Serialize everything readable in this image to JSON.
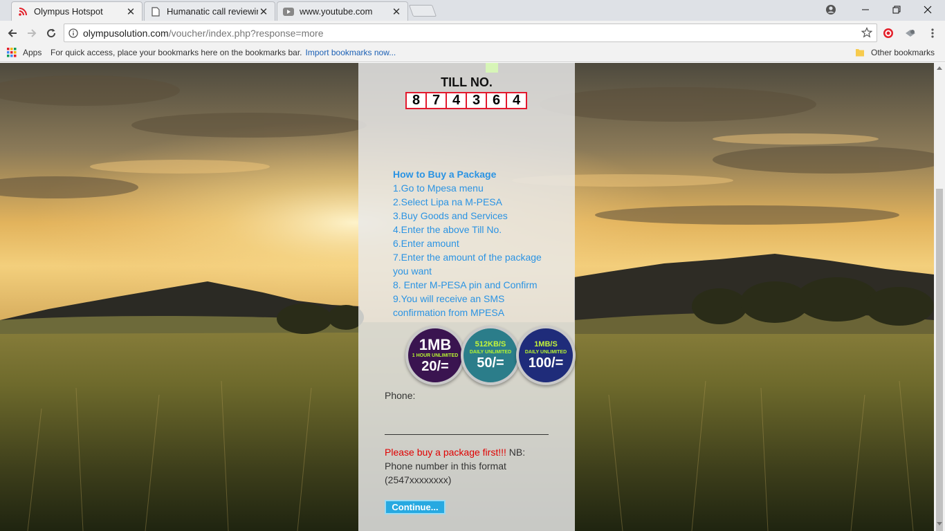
{
  "browser": {
    "tabs": [
      {
        "title": "Olympus Hotspot",
        "icon": "wifi-icon",
        "active": true
      },
      {
        "title": "Humanatic call reviewing",
        "icon": "document-icon",
        "active": false
      },
      {
        "title": "www.youtube.com",
        "icon": "youtube-icon",
        "active": false
      }
    ],
    "url": {
      "host": "olympusolution.com",
      "path": "/voucher/index.php?response=more"
    },
    "bookmarks": {
      "apps_label": "Apps",
      "hint": "For quick access, place your bookmarks here on the bookmarks bar.",
      "import_link": "Import bookmarks now...",
      "other_label": "Other bookmarks"
    }
  },
  "page": {
    "till_label": "TILL NO.",
    "till_digits": [
      "8",
      "7",
      "4",
      "3",
      "6",
      "4"
    ],
    "howto": {
      "title": "How to Buy a Package",
      "steps": [
        "1.Go to Mpesa menu",
        "2.Select Lipa na M-PESA",
        "3.Buy Goods and Services",
        "4.Enter the above Till No.",
        "6.Enter amount",
        "7.Enter the amount of the package you want",
        "8. Enter M-PESA pin and Confirm",
        "9.You will receive an SMS confirmation from MPESA"
      ]
    },
    "packages": [
      {
        "top": "1MB",
        "sub": "1 HOUR UNLIMITED",
        "price": "20/=",
        "color": "#3a1450"
      },
      {
        "top": "512KB/S",
        "sub": "DAILY UNLIMITED",
        "price": "50/=",
        "color": "#2b7d8a"
      },
      {
        "top": "1MB/S",
        "sub": "DAILY UNLIMITED",
        "price": "100/=",
        "color": "#1f2c7a"
      }
    ],
    "phone_label": "Phone:",
    "phone_value": "",
    "warning": "Please buy a package first!!!",
    "nb_text": " NB: Phone number in this format (2547xxxxxxxx)",
    "continue_label": "Continue..."
  }
}
